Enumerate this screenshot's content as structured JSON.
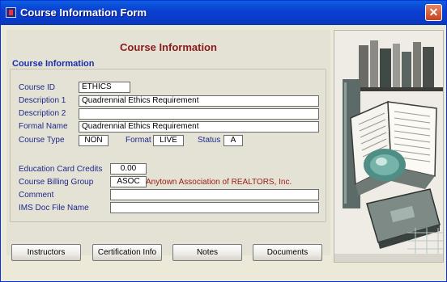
{
  "window": {
    "title": "Course Information Form",
    "close_glyph": "✕"
  },
  "form": {
    "heading": "Course Information",
    "group_title": "Course Information",
    "course_id": {
      "label": "Course ID",
      "value": "ETHICS"
    },
    "description1": {
      "label": "Description 1",
      "value": "Quadrennial Ethics Requirement"
    },
    "description2": {
      "label": "Description 2",
      "value": ""
    },
    "formal_name": {
      "label": "Formal Name",
      "value": "Quadrennial Ethics Requirement"
    },
    "course_type": {
      "label": "Course Type",
      "value": "NON"
    },
    "format": {
      "label": "Format",
      "value": "LIVE"
    },
    "status": {
      "label": "Status",
      "value": "A"
    },
    "education_card_credits": {
      "label": "Education Card Credits",
      "value": "0.00"
    },
    "billing_group": {
      "label": "Course Billing Group",
      "code": "ASOC",
      "name": "Anytown Association of REALTORS, Inc."
    },
    "comment": {
      "label": "Comment",
      "value": ""
    },
    "ims_doc_file_name": {
      "label": "IMS Doc File Name",
      "value": ""
    }
  },
  "buttons": {
    "instructors": "Instructors",
    "certification_info": "Certification Info",
    "notes": "Notes",
    "documents": "Documents"
  },
  "icons": {
    "app": "app-icon",
    "close": "close-icon",
    "illustration": "books-illustration"
  },
  "colors": {
    "titlebar": "#0b3fd1",
    "heading": "#8b1a1a",
    "labels": "#1d2a8c",
    "association_name": "#9a1d10",
    "close_button": "#c7421d"
  }
}
